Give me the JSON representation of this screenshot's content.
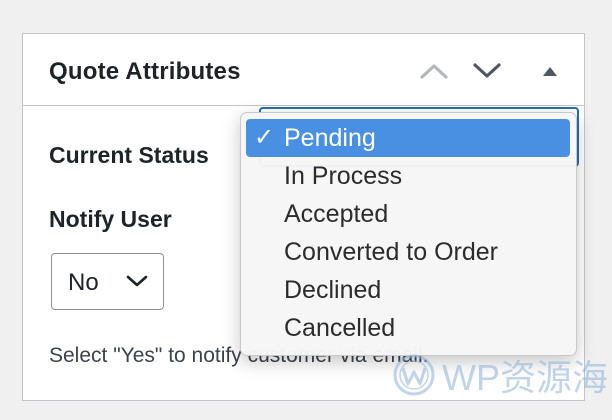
{
  "metabox": {
    "title": "Quote Attributes",
    "icons": {
      "up": "chevron-up-icon",
      "down": "chevron-down-icon",
      "toggle": "triangle-up-icon"
    }
  },
  "fields": {
    "status_label": "Current Status",
    "notify_label": "Notify User",
    "notify_value": "No",
    "hint": "Select \"Yes\" to notify customer via email."
  },
  "status_dropdown": {
    "selected": "Pending",
    "check_glyph": "✓",
    "options": [
      {
        "label": "Pending",
        "selected": true
      },
      {
        "label": "In Process"
      },
      {
        "label": "Accepted"
      },
      {
        "label": "Converted to Order"
      },
      {
        "label": "Declined"
      },
      {
        "label": "Cancelled"
      }
    ],
    "highlight_color": "#4a90e2"
  },
  "colors": {
    "focus_border": "#2271b1",
    "text": "#1d2327"
  },
  "watermark": {
    "text": "WP资源海"
  }
}
